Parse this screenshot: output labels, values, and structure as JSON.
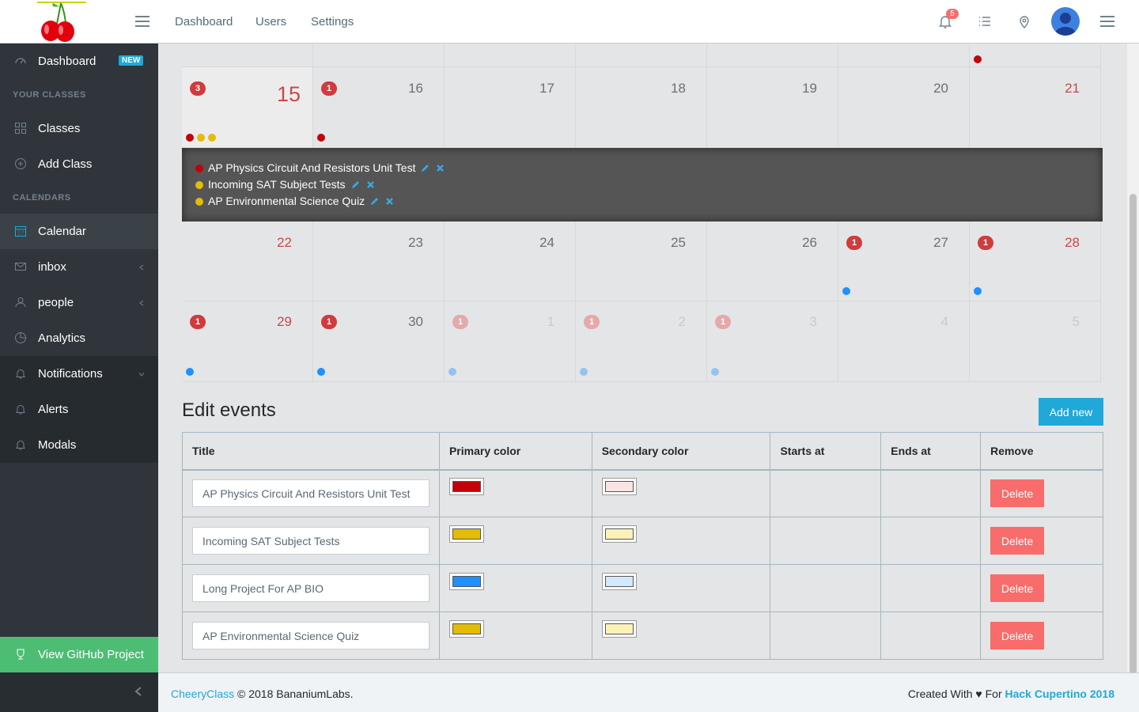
{
  "header": {
    "nav": [
      "Dashboard",
      "Users",
      "Settings"
    ],
    "notification_count": "5"
  },
  "sidebar": {
    "dashboard": {
      "label": "Dashboard",
      "badge": "NEW"
    },
    "section_classes": "YOUR CLASSES",
    "classes": "Classes",
    "add_class": "Add Class",
    "section_calendars": "CALENDARS",
    "calendar": "Calendar",
    "inbox": "inbox",
    "people": "people",
    "analytics": "Analytics",
    "notifications": "Notifications",
    "alerts": "Alerts",
    "modals": "Modals",
    "github": "View GitHub Project"
  },
  "calendar": {
    "weeks": [
      {
        "days": [
          {
            "day": "15",
            "badge": "3",
            "dots": [
              "#c4000b",
              "#e3bc08",
              "#e3bc08"
            ],
            "weekend": true,
            "open": true
          },
          {
            "day": "16",
            "badge": "1",
            "dots": [
              "#c4000b"
            ]
          },
          {
            "day": "17"
          },
          {
            "day": "18"
          },
          {
            "day": "19"
          },
          {
            "day": "20"
          },
          {
            "day": "21",
            "weekend": true
          }
        ]
      },
      {
        "days": [
          {
            "day": "22",
            "weekend": true
          },
          {
            "day": "23"
          },
          {
            "day": "24"
          },
          {
            "day": "25"
          },
          {
            "day": "26"
          },
          {
            "day": "27",
            "badge": "1",
            "dots": [
              "#1e90ff"
            ]
          },
          {
            "day": "28",
            "badge": "1",
            "dots": [
              "#1e90ff"
            ],
            "weekend": true
          }
        ]
      },
      {
        "days": [
          {
            "day": "29",
            "badge": "1",
            "dots": [
              "#1e90ff"
            ],
            "weekend": true
          },
          {
            "day": "30",
            "badge": "1",
            "dots": [
              "#1e90ff"
            ]
          },
          {
            "day": "1",
            "badge": "1",
            "dots": [
              "#1e90ff"
            ],
            "out": true
          },
          {
            "day": "2",
            "badge": "1",
            "dots": [
              "#1e90ff"
            ],
            "out": true
          },
          {
            "day": "3",
            "badge": "1",
            "dots": [
              "#1e90ff"
            ],
            "out": true
          },
          {
            "day": "4",
            "out": true
          },
          {
            "day": "5",
            "out": true
          }
        ]
      }
    ],
    "open_events": [
      {
        "title": "AP Physics Circuit And Resistors Unit Test",
        "color": "#c4000b"
      },
      {
        "title": "Incoming SAT Subject Tests",
        "color": "#e3bc08"
      },
      {
        "title": "AP Environmental Science Quiz",
        "color": "#e3bc08"
      }
    ]
  },
  "edit_events": {
    "title": "Edit events",
    "add_button": "Add new",
    "columns": [
      "Title",
      "Primary color",
      "Secondary color",
      "Starts at",
      "Ends at",
      "Remove"
    ],
    "rows": [
      {
        "title": "AP Physics Circuit And Resistors Unit Test",
        "primary": "#c4000b",
        "secondary": "#fae3e3",
        "starts": "",
        "ends": "",
        "action": "Delete"
      },
      {
        "title": "Incoming SAT Subject Tests",
        "primary": "#e3bc08",
        "secondary": "#fdf1ba",
        "starts": "",
        "ends": "",
        "action": "Delete"
      },
      {
        "title": "Long Project For AP BIO",
        "primary": "#1e90ff",
        "secondary": "#d1e8ff",
        "starts": "",
        "ends": "",
        "action": "Delete"
      },
      {
        "title": "AP Environmental Science Quiz",
        "primary": "#e3bc08",
        "secondary": "#fdf1ba",
        "starts": "",
        "ends": "",
        "action": "Delete"
      }
    ]
  },
  "footer": {
    "brand": "CheeryClass",
    "copyright": "© 2018 BananiumLabs.",
    "created_with": "Created With ♥ For",
    "event_link": "Hack Cupertino 2018"
  }
}
